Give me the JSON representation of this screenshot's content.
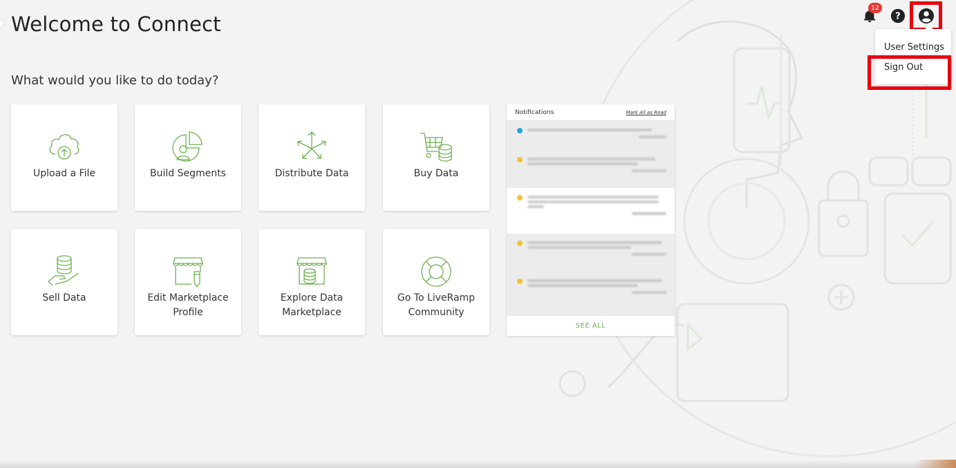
{
  "header": {
    "title": "Welcome to Connect",
    "notification_count": "12",
    "notification_icon": "bell-icon",
    "help_icon": "help-circle-icon",
    "profile_icon": "user-circle-icon"
  },
  "user_menu": {
    "items": [
      {
        "label": "User Settings"
      },
      {
        "label": "Sign Out"
      }
    ]
  },
  "main": {
    "prompt": "What would you like to do today?",
    "tiles": [
      {
        "label": "Upload a File",
        "icon": "cloud-upload-icon"
      },
      {
        "label": "Build Segments",
        "icon": "segment-pie-icon"
      },
      {
        "label": "Distribute Data",
        "icon": "distribute-arrows-icon"
      },
      {
        "label": "Buy Data",
        "icon": "cart-database-icon"
      },
      {
        "label": "Sell Data",
        "icon": "hand-database-icon"
      },
      {
        "label": "Edit Marketplace Profile",
        "icon": "storefront-edit-icon"
      },
      {
        "label": "Explore Data Marketplace",
        "icon": "storefront-database-icon"
      },
      {
        "label": "Go To LiveRamp Community",
        "icon": "lifebuoy-icon"
      }
    ]
  },
  "notifications": {
    "title": "Notifications",
    "mark_all": "Mark All as Read",
    "see_all": "SEE ALL",
    "colors": {
      "info": "#29a3e0",
      "warning": "#f2c230",
      "accent": "#6ab04c"
    }
  }
}
